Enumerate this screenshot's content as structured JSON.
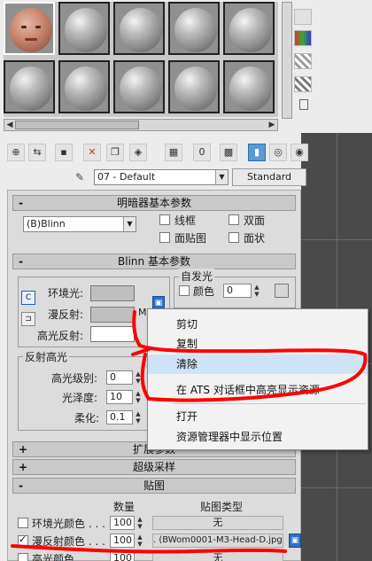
{
  "material": {
    "name": "07 - Default",
    "type_button": "Standard"
  },
  "rollouts": {
    "shader_basic": {
      "sign": "-",
      "title": "明暗器基本参数",
      "shader": "(B)Blinn",
      "wire": "线框",
      "two_sided": "双面",
      "face_map": "面贴图",
      "faceted": "面状"
    },
    "blinn_basic": {
      "sign": "-",
      "title": "Blinn 基本参数",
      "self_illum_title": "自发光",
      "color_label": "颜色",
      "color_value": "0",
      "ambient": "环境光:",
      "diffuse": "漫反射:",
      "specular": "高光反射:",
      "m_label": "M"
    },
    "specular_highlights": {
      "title": "反射高光",
      "level_label": "高光级别:",
      "level_value": "0",
      "gloss_label": "光泽度:",
      "gloss_value": "10",
      "soften_label": "柔化:",
      "soften_value": "0.1"
    },
    "extended": {
      "sign": "+",
      "title": "扩展参数"
    },
    "supersampling": {
      "sign": "+",
      "title": "超级采样"
    },
    "maps": {
      "sign": "-",
      "title": "贴图",
      "col_amount": "数量",
      "col_map_type": "贴图类型",
      "rows": [
        {
          "label": "环境光颜色 . . .",
          "amount": "100",
          "map": "无",
          "checked": false
        },
        {
          "label": "漫反射颜色 . . .",
          "amount": "100",
          "map": ". (BWom0001-M3-Head-D.jpg)",
          "checked": true
        },
        {
          "label": "高光颜色 . . .",
          "amount": "100",
          "map": "无",
          "checked": false
        }
      ]
    }
  },
  "context_menu": {
    "items": [
      "剪切",
      "复制",
      "清除",
      "在 ATS 对话框中高亮显示资源",
      "打开",
      "资源管理器中显示位置"
    ],
    "highlighted": "清除"
  },
  "colors": {
    "annotation": "#ff0000",
    "highlight": "#cfe3f7",
    "active_blue": "#5b9bd5"
  }
}
